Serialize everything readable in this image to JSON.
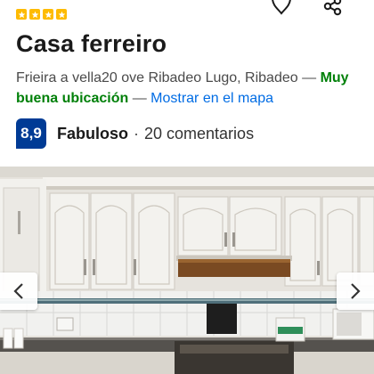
{
  "header": {
    "star_rating": 4,
    "star_color": "#febb02",
    "icons": [
      "star-icon",
      "heart-icon",
      "share-icon"
    ]
  },
  "property": {
    "name": "Casa ferreiro",
    "address": "Frieira a vella20 ove Ribadeo Lugo, Ribadeo",
    "separator": "—",
    "location_badge": "Muy buena ubicación",
    "map_link": "Mostrar en el mapa"
  },
  "rating": {
    "score": "8,9",
    "label": "Fabuloso",
    "separator": "·",
    "reviews": "20 comentarios"
  },
  "gallery": {
    "prev_icon": "chevron-left-icon",
    "next_icon": "chevron-right-icon"
  },
  "colors": {
    "score_bg": "#003b95",
    "location_badge": "#008009",
    "link": "#006ce4"
  }
}
